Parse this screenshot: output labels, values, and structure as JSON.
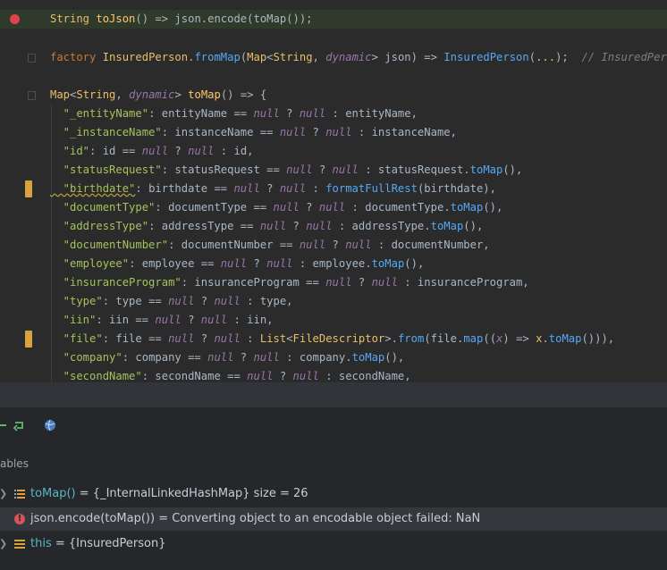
{
  "editor": {
    "lines": [
      {
        "tokens": [
          [
            "t",
            "String "
          ],
          [
            "f",
            "toJson"
          ],
          [
            "p",
            "() => json.encode(toMap());"
          ]
        ]
      },
      {
        "tokens": []
      },
      {
        "tokens": [
          [
            "k",
            "factory "
          ],
          [
            "t",
            "InsuredPerson"
          ],
          [
            "p",
            "."
          ],
          [
            "m",
            "fromMap"
          ],
          [
            "p",
            "("
          ],
          [
            "t",
            "Map"
          ],
          [
            "p",
            "<"
          ],
          [
            "t",
            "String"
          ],
          [
            "p",
            ", "
          ],
          [
            "n",
            "dynamic"
          ],
          [
            "p",
            "> json) => "
          ],
          [
            "m",
            "InsuredPerson"
          ],
          [
            "p",
            "("
          ],
          [
            "t",
            "..."
          ],
          [
            "p",
            ");  "
          ],
          [
            "c",
            "// InsuredPerson"
          ]
        ]
      },
      {
        "tokens": []
      },
      {
        "tokens": [
          [
            "t",
            "Map"
          ],
          [
            "p",
            "<"
          ],
          [
            "t",
            "String"
          ],
          [
            "p",
            ", "
          ],
          [
            "n",
            "dynamic"
          ],
          [
            "p",
            "> "
          ],
          [
            "f",
            "toMap"
          ],
          [
            "p",
            "() => {"
          ]
        ]
      },
      {
        "tokens": [
          [
            "s",
            "  \"_entityName\""
          ],
          [
            "p",
            ": entityName == "
          ],
          [
            "n",
            "null"
          ],
          [
            "p",
            " ? "
          ],
          [
            "n",
            "null"
          ],
          [
            "p",
            " : entityName,"
          ]
        ]
      },
      {
        "tokens": [
          [
            "s",
            "  \"_instanceName\""
          ],
          [
            "p",
            ": instanceName == "
          ],
          [
            "n",
            "null"
          ],
          [
            "p",
            " ? "
          ],
          [
            "n",
            "null"
          ],
          [
            "p",
            " : instanceName,"
          ]
        ]
      },
      {
        "tokens": [
          [
            "s",
            "  \"id\""
          ],
          [
            "p",
            ": id == "
          ],
          [
            "n",
            "null"
          ],
          [
            "p",
            " ? "
          ],
          [
            "n",
            "null"
          ],
          [
            "p",
            " : id,"
          ]
        ]
      },
      {
        "tokens": [
          [
            "s",
            "  \"statusRequest\""
          ],
          [
            "p",
            ": statusRequest == "
          ],
          [
            "n",
            "null"
          ],
          [
            "p",
            " ? "
          ],
          [
            "n",
            "null"
          ],
          [
            "p",
            " : statusRequest."
          ],
          [
            "m",
            "toMap"
          ],
          [
            "p",
            "(),"
          ]
        ]
      },
      {
        "tokens": [
          [
            "s",
            "  \"birthdate\""
          ],
          [
            "p",
            ": birthdate == "
          ],
          [
            "n",
            "null"
          ],
          [
            "p",
            " ? "
          ],
          [
            "n",
            "null"
          ],
          [
            "p",
            " : "
          ],
          [
            "m",
            "formatFullRest"
          ],
          [
            "p",
            "(birthdate),"
          ]
        ]
      },
      {
        "tokens": [
          [
            "s",
            "  \"documentType\""
          ],
          [
            "p",
            ": documentType == "
          ],
          [
            "n",
            "null"
          ],
          [
            "p",
            " ? "
          ],
          [
            "n",
            "null"
          ],
          [
            "p",
            " : documentType."
          ],
          [
            "m",
            "toMap"
          ],
          [
            "p",
            "(),"
          ]
        ]
      },
      {
        "tokens": [
          [
            "s",
            "  \"addressType\""
          ],
          [
            "p",
            ": addressType == "
          ],
          [
            "n",
            "null"
          ],
          [
            "p",
            " ? "
          ],
          [
            "n",
            "null"
          ],
          [
            "p",
            " : addressType."
          ],
          [
            "m",
            "toMap"
          ],
          [
            "p",
            "(),"
          ]
        ]
      },
      {
        "tokens": [
          [
            "s",
            "  \"documentNumber\""
          ],
          [
            "p",
            ": documentNumber == "
          ],
          [
            "n",
            "null"
          ],
          [
            "p",
            " ? "
          ],
          [
            "n",
            "null"
          ],
          [
            "p",
            " : documentNumber,"
          ]
        ]
      },
      {
        "tokens": [
          [
            "s",
            "  \"employee\""
          ],
          [
            "p",
            ": employee == "
          ],
          [
            "n",
            "null"
          ],
          [
            "p",
            " ? "
          ],
          [
            "n",
            "null"
          ],
          [
            "p",
            " : employee."
          ],
          [
            "m",
            "toMap"
          ],
          [
            "p",
            "(),"
          ]
        ]
      },
      {
        "tokens": [
          [
            "s",
            "  \"insuranceProgram\""
          ],
          [
            "p",
            ": insuranceProgram == "
          ],
          [
            "n",
            "null"
          ],
          [
            "p",
            " ? "
          ],
          [
            "n",
            "null"
          ],
          [
            "p",
            " : insuranceProgram,"
          ]
        ]
      },
      {
        "tokens": [
          [
            "s",
            "  \"type\""
          ],
          [
            "p",
            ": type == "
          ],
          [
            "n",
            "null"
          ],
          [
            "p",
            " ? "
          ],
          [
            "n",
            "null"
          ],
          [
            "p",
            " : type,"
          ]
        ]
      },
      {
        "tokens": [
          [
            "s",
            "  \"iin\""
          ],
          [
            "p",
            ": iin == "
          ],
          [
            "n",
            "null"
          ],
          [
            "p",
            " ? "
          ],
          [
            "n",
            "null"
          ],
          [
            "p",
            " : iin,"
          ]
        ]
      },
      {
        "tokens": [
          [
            "s",
            "  \"file\""
          ],
          [
            "p",
            ": file == "
          ],
          [
            "n",
            "null"
          ],
          [
            "p",
            " ? "
          ],
          [
            "n",
            "null"
          ],
          [
            "p",
            " : "
          ],
          [
            "t",
            "List"
          ],
          [
            "p",
            "<"
          ],
          [
            "t",
            "FileDescriptor"
          ],
          [
            "p",
            ">."
          ],
          [
            "m",
            "from"
          ],
          [
            "p",
            "(file."
          ],
          [
            "m",
            "map"
          ],
          [
            "p",
            "(("
          ],
          [
            "n",
            "x"
          ],
          [
            "p",
            ") => "
          ],
          [
            "t",
            "x"
          ],
          [
            "p",
            "."
          ],
          [
            "m",
            "toMap"
          ],
          [
            "p",
            "())),"
          ]
        ]
      },
      {
        "tokens": [
          [
            "s",
            "  \"company\""
          ],
          [
            "p",
            ": company == "
          ],
          [
            "n",
            "null"
          ],
          [
            "p",
            " ? "
          ],
          [
            "n",
            "null"
          ],
          [
            "p",
            " : company."
          ],
          [
            "m",
            "toMap"
          ],
          [
            "p",
            "(),"
          ]
        ]
      },
      {
        "tokens": [
          [
            "s",
            "  \"secondName\""
          ],
          [
            "p",
            ": secondName == "
          ],
          [
            "n",
            "null"
          ],
          [
            "p",
            " ? "
          ],
          [
            "n",
            "null"
          ],
          [
            "p",
            " : secondName,"
          ]
        ]
      }
    ]
  },
  "debug": {
    "tab_label": "ables",
    "variables": [
      {
        "name": "toMap()",
        "value": " = {_InternalLinkedHashMap} size = 26"
      },
      {
        "name": "",
        "value": "json.encode(toMap()) = Converting object to an encodable object failed: NaN"
      },
      {
        "name": "this",
        "value": " = {InsuredPerson}"
      }
    ]
  },
  "colors": {
    "breakpoint": "#e0434f",
    "warning_marker": "#d9a13b",
    "variable_name": "#56b6c2"
  },
  "icons": [
    "breakpoint-icon",
    "fold-icon",
    "restart-icon",
    "globe-icon",
    "list-icon",
    "error-icon",
    "chevron-right-icon"
  ]
}
